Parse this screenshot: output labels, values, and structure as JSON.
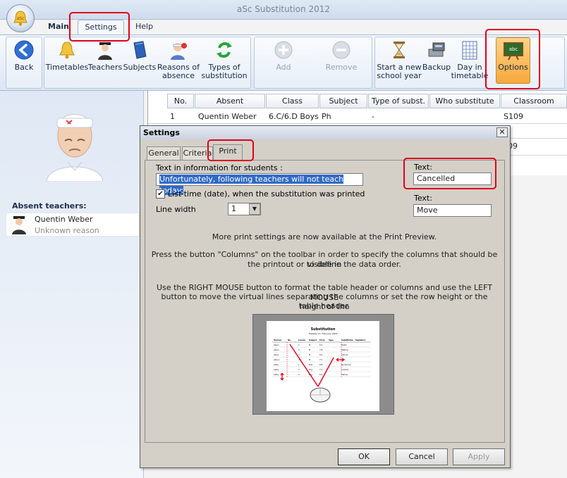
{
  "app": {
    "title": "aSc Substitution 2012",
    "orb_label": "aSc"
  },
  "ribbon_tabs": [
    {
      "label": "Main"
    },
    {
      "label": "Settings"
    },
    {
      "label": "Help"
    }
  ],
  "ribbon": {
    "back": {
      "label": "Back"
    },
    "timetables": {
      "label": "Timetables"
    },
    "teachers": {
      "label": "Teachers"
    },
    "subjects": {
      "label": "Subjects"
    },
    "reasons": {
      "label_line1": "Reasons of",
      "label_line2": "absence"
    },
    "types": {
      "label_line1": "Types of",
      "label_line2": "substitution"
    },
    "add": {
      "label": "Add"
    },
    "remove": {
      "label": "Remove"
    },
    "new_year": {
      "label_line1": "Start a new",
      "label_line2": "school year"
    },
    "backup": {
      "label": "Backup"
    },
    "day_in_timetable": {
      "label_line1": "Day in",
      "label_line2": "timetable"
    },
    "options": {
      "label": "Options",
      "icon_text": "abc"
    }
  },
  "left_panel": {
    "heading": "Absent teachers:",
    "teacher": {
      "name": "Quentin Weber",
      "reason": "Unknown reason"
    }
  },
  "grid": {
    "columns": [
      "No.",
      "Absent",
      "Class",
      "Subject",
      "Type of subst.",
      "Who substitute",
      "Classroom"
    ],
    "row": {
      "no": "1",
      "absent": "Quentin Weber",
      "class": "6.C/6.D Boys",
      "subject": "Ph",
      "type": "-",
      "who": "",
      "classroom": "S109"
    },
    "partial_cell": "09"
  },
  "dialog": {
    "title": "Settings",
    "close_glyph": "✕",
    "tabs": [
      "General",
      "Criteria",
      "Print"
    ],
    "info_label": "Text in information for students :",
    "info_value": "Unfortunately, following teachers will not teach today:",
    "list_time_checked": true,
    "check_glyph": "✔",
    "list_time_label": "List time (date), when the substitution was printed",
    "line_width_label": "Line width",
    "line_width_value": "1",
    "text1_label": "Text:",
    "text1_value": "Cancelled",
    "text2_label": "Text:",
    "text2_value": "Move",
    "para1": "More print settings are now available at the Print Preview.",
    "para2_line1": "Press the button \"Columns\" on the toolbar in order to specify the columns that should be visible in",
    "para2_line2": "the printout or to define the data order.",
    "para3_line1": "Use the RIGHT MOUSE button to format the table header or columns and use the LEFT MOUSE",
    "para3_line2": "button to move the virtual lines separating the columns or set the row height or the height of the",
    "para3_line3": "table header.",
    "preview": {
      "title": "Substitution",
      "date": "Tuesday 11. February 2003",
      "headers": [
        "Teacher",
        "No.",
        "Lesson",
        "Subject",
        "Form",
        "Type",
        "Substitutes",
        "Signature"
      ],
      "rows": [
        [
          "Alison",
          "-",
          "1",
          "M",
          "6.A",
          "-",
          "Elston",
          ""
        ],
        [
          "Alison",
          "-",
          "2",
          "M",
          "7.B",
          "-",
          "Hatting",
          ""
        ],
        [
          "Alison",
          "-",
          "3",
          "M",
          "8.A",
          "-",
          "Adrovic",
          ""
        ],
        [
          "Allison",
          "-",
          "4",
          "M",
          "7.C",
          "-",
          "Josh",
          ""
        ],
        [
          "Cathy",
          "-",
          "1",
          "Eng",
          "6.B",
          "-",
          "Mendonce",
          ""
        ],
        [
          "Cathy",
          "-",
          "2",
          "Eng",
          "7.A",
          "-",
          "Lohman",
          ""
        ],
        [
          "Cathy",
          "-",
          "3",
          "Eng",
          "6.A",
          "-",
          "Harlow",
          ""
        ]
      ]
    },
    "buttons": {
      "ok": "OK",
      "cancel": "Cancel",
      "apply": "Apply"
    }
  },
  "colors": {
    "highlight": "#e0001b",
    "selection": "#316ac5",
    "options_button": "#f7a83b"
  }
}
